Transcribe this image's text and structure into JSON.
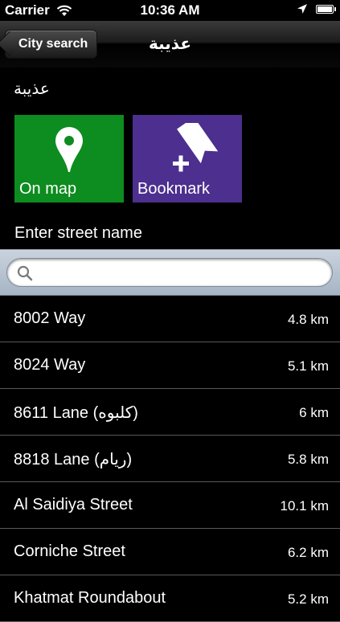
{
  "status_bar": {
    "carrier": "Carrier",
    "time": "10:36 AM",
    "icons": [
      "wifi-icon",
      "location-arrow-icon",
      "battery-icon"
    ]
  },
  "nav": {
    "back_label": "City search",
    "title": "عذيبة"
  },
  "city_name": "عذيبة",
  "tiles": {
    "map": {
      "label": "On map",
      "icon": "map-pin-icon",
      "color": "#0d8c1f"
    },
    "bookmark": {
      "label": "Bookmark",
      "icon": "bookmark-add-icon",
      "color": "#4c2f8f"
    }
  },
  "street_prompt": "Enter street name",
  "search": {
    "value": "",
    "placeholder": ""
  },
  "streets": [
    {
      "name": "8002 Way",
      "distance": "4.8 km"
    },
    {
      "name": "8024 Way",
      "distance": "5.1 km"
    },
    {
      "name": "8611 Lane (كلبوه)",
      "distance": "6 km"
    },
    {
      "name": "8818 Lane (ريام)",
      "distance": "5.8 km"
    },
    {
      "name": "Al Saidiya Street",
      "distance": "10.1 km"
    },
    {
      "name": "Corniche Street",
      "distance": "6.2 km"
    },
    {
      "name": "Khatmat Roundabout",
      "distance": "5.2 km"
    }
  ]
}
